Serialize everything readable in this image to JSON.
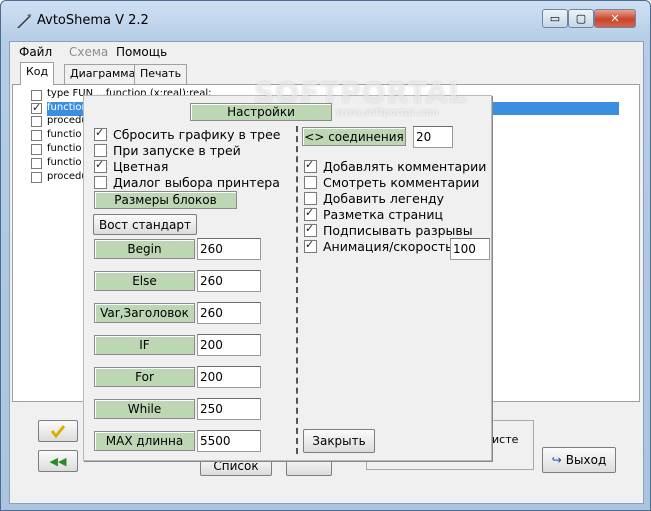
{
  "window": {
    "title": "AvtoShema V 2.2",
    "controls": {
      "minimize": "▭",
      "restore": "▢",
      "close": "✕"
    }
  },
  "menu": {
    "file": "Файл",
    "scheme": "Схема",
    "help": "Помощь"
  },
  "tabs": {
    "code": "Код",
    "diagram": "Диаграмма",
    "print": "Печать"
  },
  "code_list": [
    {
      "text": "type FUN ...function (x:real):real;",
      "checked": false
    },
    {
      "text": "function",
      "checked": true
    },
    {
      "text": "procedu",
      "checked": false
    },
    {
      "text": " functio",
      "checked": false
    },
    {
      "text": " functio",
      "checked": false
    },
    {
      "text": " functio",
      "checked": false
    },
    {
      "text": "procedu",
      "checked": false
    }
  ],
  "settings": {
    "header": "Настройки",
    "left_options": [
      {
        "label": "Сбросить графику в трее",
        "checked": true
      },
      {
        "label": "При запуске в трей",
        "checked": false
      },
      {
        "label": "Цветная",
        "checked": true
      },
      {
        "label": "Диалог выбора принтера",
        "checked": false
      }
    ],
    "block_sizes_label": "Размеры блоков",
    "restore_default": "Вост стандарт",
    "blocks": [
      {
        "label": "Begin",
        "value": "260"
      },
      {
        "label": "Else",
        "value": "260"
      },
      {
        "label": "Var,Заголовок",
        "value": "260"
      },
      {
        "label": "IF",
        "value": "200"
      },
      {
        "label": "For",
        "value": "200"
      },
      {
        "label": "While",
        "value": "250"
      },
      {
        "label": "MAX длинна",
        "value": "5500"
      }
    ],
    "connections_label": "<> соединения",
    "connections_value": "20",
    "right_options": [
      {
        "label": "Добавлять комментарии",
        "checked": true
      },
      {
        "label": "Смотреть комментарии",
        "checked": false
      },
      {
        "label": "Добавить легенду",
        "checked": false
      },
      {
        "label": "Разметка страниц",
        "checked": true
      },
      {
        "label": "Подписывать разрывы",
        "checked": true
      },
      {
        "label": "Анимация/скорость",
        "checked": true
      }
    ],
    "animation_value": "100",
    "close": "Закрыть"
  },
  "bottom": {
    "list_button": "Список",
    "partial_text": "листе",
    "exit_button": "Выход",
    "back_arrows": "◀◀"
  },
  "watermark": {
    "brand": "SOFTPORTAL",
    "url": "www.softportal.com"
  },
  "colors": {
    "selection": "#3b8ee0",
    "green_label": "#bdd7b5",
    "window_frame": "#b5cde6"
  }
}
